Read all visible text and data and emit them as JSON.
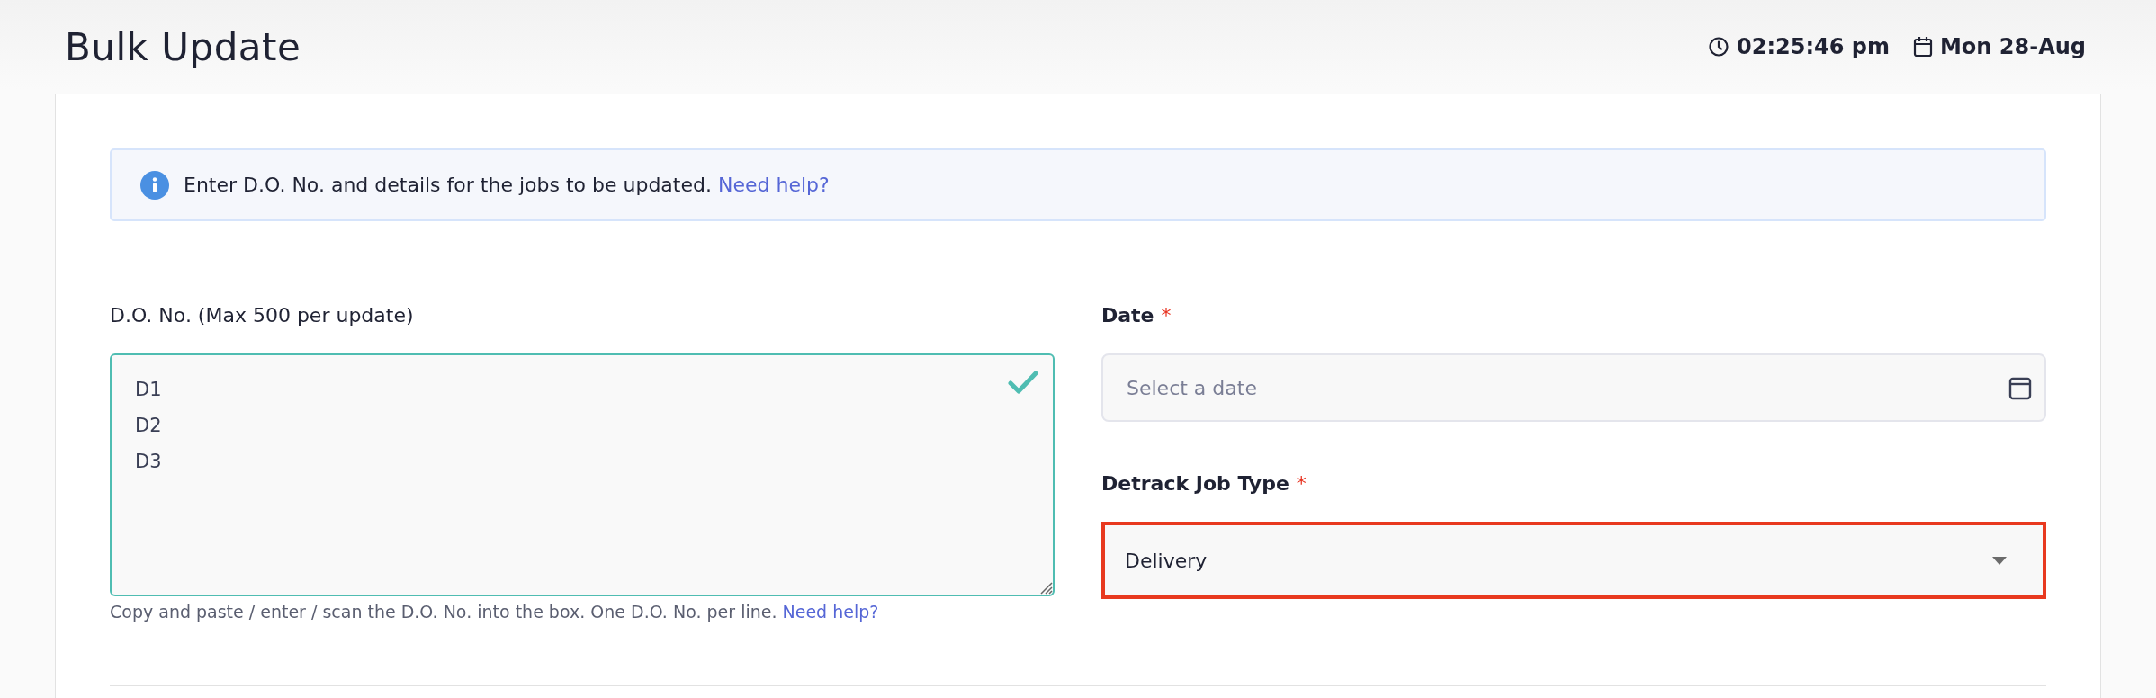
{
  "header": {
    "title": "Bulk Update",
    "time": "02:25:46 pm",
    "date": "Mon 28-Aug"
  },
  "info": {
    "text": "Enter D.O. No. and details for the jobs to be updated.",
    "link": "Need help?"
  },
  "do_numbers": {
    "label": "D.O. No. (Max 500 per update)",
    "value": "D1\nD2\nD3",
    "valid": true,
    "hint": "Copy and paste / enter / scan the D.O. No. into the box. One D.O. No. per line.",
    "hint_link": "Need help?"
  },
  "date_field": {
    "label": "Date",
    "required": true,
    "required_mark": "*",
    "placeholder": "Select a date"
  },
  "job_type": {
    "label": "Detrack Job Type",
    "required": true,
    "required_mark": "*",
    "value": "Delivery",
    "error": true
  }
}
